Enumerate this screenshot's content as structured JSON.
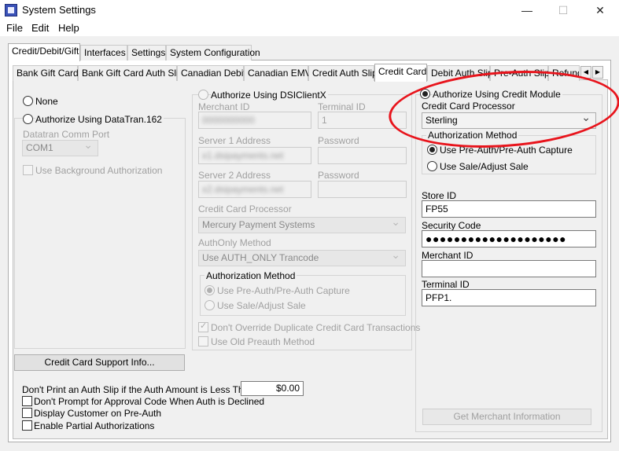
{
  "window": {
    "title": "System Settings",
    "min_glyph": "—",
    "max_glyph": "☐",
    "close_glyph": "✕"
  },
  "menu": {
    "items": [
      "File",
      "Edit",
      "Help"
    ]
  },
  "main_tabs": [
    "Credit/Debit/Gift",
    "Interfaces",
    "Settings",
    "System Configuration"
  ],
  "sub_tabs": [
    "Bank Gift Card",
    "Bank Gift Card Auth Slip",
    "Canadian Debit",
    "Canadian EMV",
    "Credit Auth Slip",
    "Credit Card",
    "Debit Auth Slip",
    "Pre-Auth Slip",
    "Refund"
  ],
  "tab_scroll": {
    "left": "◀",
    "right": "▶"
  },
  "left": {
    "none_label": "None",
    "datatran_label": "Authorize Using DataTran.162",
    "comm_port_label": "Datatran Comm Port",
    "comm_port_value": "COM1",
    "background_auth_label": "Use Background Authorization",
    "support_button": "Credit Card Support Info..."
  },
  "dsi": {
    "label": "Authorize Using DSIClientX",
    "merchant_id_label": "Merchant ID",
    "merchant_id_value": "0000000000",
    "terminal_id_label": "Terminal ID",
    "terminal_id_value": "1",
    "server1_label": "Server 1 Address",
    "server1_value": "x1.dsipayments.net",
    "password1_label": "Password",
    "server2_label": "Server 2 Address",
    "server2_value": "x2.dsipayments.net",
    "password2_label": "Password",
    "processor_label": "Credit Card Processor",
    "processor_value": "Mercury Payment Systems",
    "authonly_label": "AuthOnly Method",
    "authonly_value": "Use AUTH_ONLY Trancode",
    "auth_method_title": "Authorization Method",
    "preauth_label": "Use Pre-Auth/Pre-Auth Capture",
    "sale_label": "Use Sale/Adjust Sale",
    "no_override_label": "Don't Override Duplicate Credit Card Transactions",
    "old_preauth_label": "Use Old Preauth Method"
  },
  "credit_module": {
    "label": "Authorize Using Credit Module",
    "processor_label": "Credit Card Processor",
    "processor_value": "Sterling",
    "auth_method_title": "Authorization Method",
    "preauth_label": "Use Pre-Auth/Pre-Auth Capture",
    "sale_label": "Use Sale/Adjust Sale",
    "store_id_label": "Store ID",
    "store_id_value": "FP55",
    "security_code_label": "Security Code",
    "security_code_value": "●●●●●●●●●●●●●●●●●●●●",
    "merchant_id_label": "Merchant ID",
    "merchant_id_value": "",
    "terminal_id_label": "Terminal ID",
    "terminal_id_value": "PFP1.",
    "get_merchant_button": "Get Merchant Information"
  },
  "bottom": {
    "min_amount_label": "Don't Print an Auth Slip if the Auth Amount is Less Than",
    "min_amount_value": "$0.00",
    "no_prompt_label": "Don't Prompt for Approval Code When Auth is Declined",
    "display_customer_label": "Display Customer on Pre-Auth",
    "partial_auth_label": "Enable Partial Authorizations"
  },
  "colors": {
    "annotation": "#e8141c",
    "panel": "#ffffff",
    "background": "#f0f0f0"
  }
}
